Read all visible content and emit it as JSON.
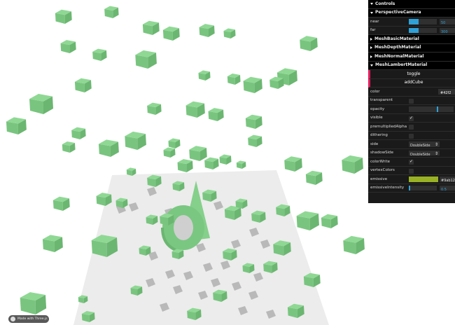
{
  "gui": {
    "controls_label": "Controls",
    "camera_folder": "PerspectiveCamera",
    "near": {
      "label": "near",
      "value": "50"
    },
    "far": {
      "label": "far",
      "value": "300"
    },
    "basic_folder": "MeshBasicMaterial",
    "depth_folder": "MeshDepthMaterial",
    "normal_folder": "MeshNormalMaterial",
    "lambert_folder": "MeshLambertMaterial",
    "toggle_label": "toggle",
    "addcube_label": "addCube",
    "color": {
      "label": "color",
      "value": "#42f2"
    },
    "transparent_label": "transparent",
    "opacity_label": "opacity",
    "visible_label": "visible",
    "premultiplied_label": "premultipliedAlpha",
    "dithering_label": "dithering",
    "side": {
      "label": "side",
      "value": "DoubleSide"
    },
    "shadowside": {
      "label": "shadowSide",
      "value": "DoubleSide"
    },
    "colorwrite_label": "colorWrite",
    "vertexcolors_label": "vertexColors",
    "emissive": {
      "label": "emissive",
      "value": "#9ab124"
    },
    "emissive_intensity": {
      "label": "emissiveIntensity",
      "value": "0.5"
    }
  },
  "badge": {
    "text": "Made with Three.js"
  },
  "colors": {
    "cube": "#8fd894",
    "floor": "#ececec",
    "shadow": "#b9b9b9",
    "emissive": "#99b124"
  }
}
